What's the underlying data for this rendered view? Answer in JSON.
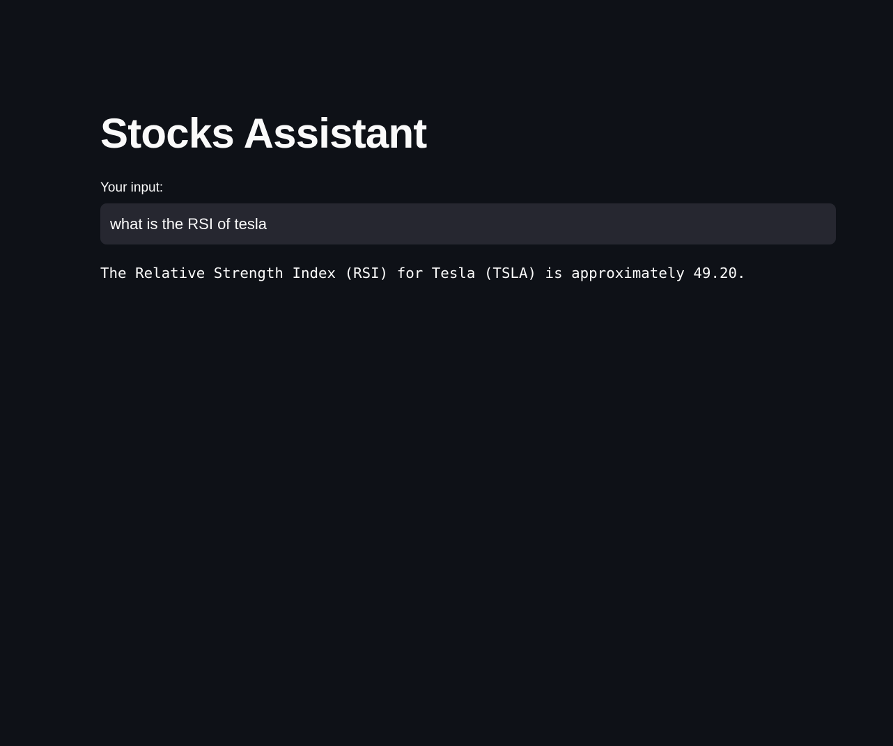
{
  "app": {
    "title": "Stocks Assistant"
  },
  "input": {
    "label": "Your input:",
    "value": "what is the RSI of tesla"
  },
  "response": {
    "text": "The Relative Strength Index (RSI) for Tesla (TSLA) is approximately 49.20."
  },
  "colors": {
    "background": "#0e1117",
    "input_background": "#262730",
    "text": "#fafafa"
  }
}
